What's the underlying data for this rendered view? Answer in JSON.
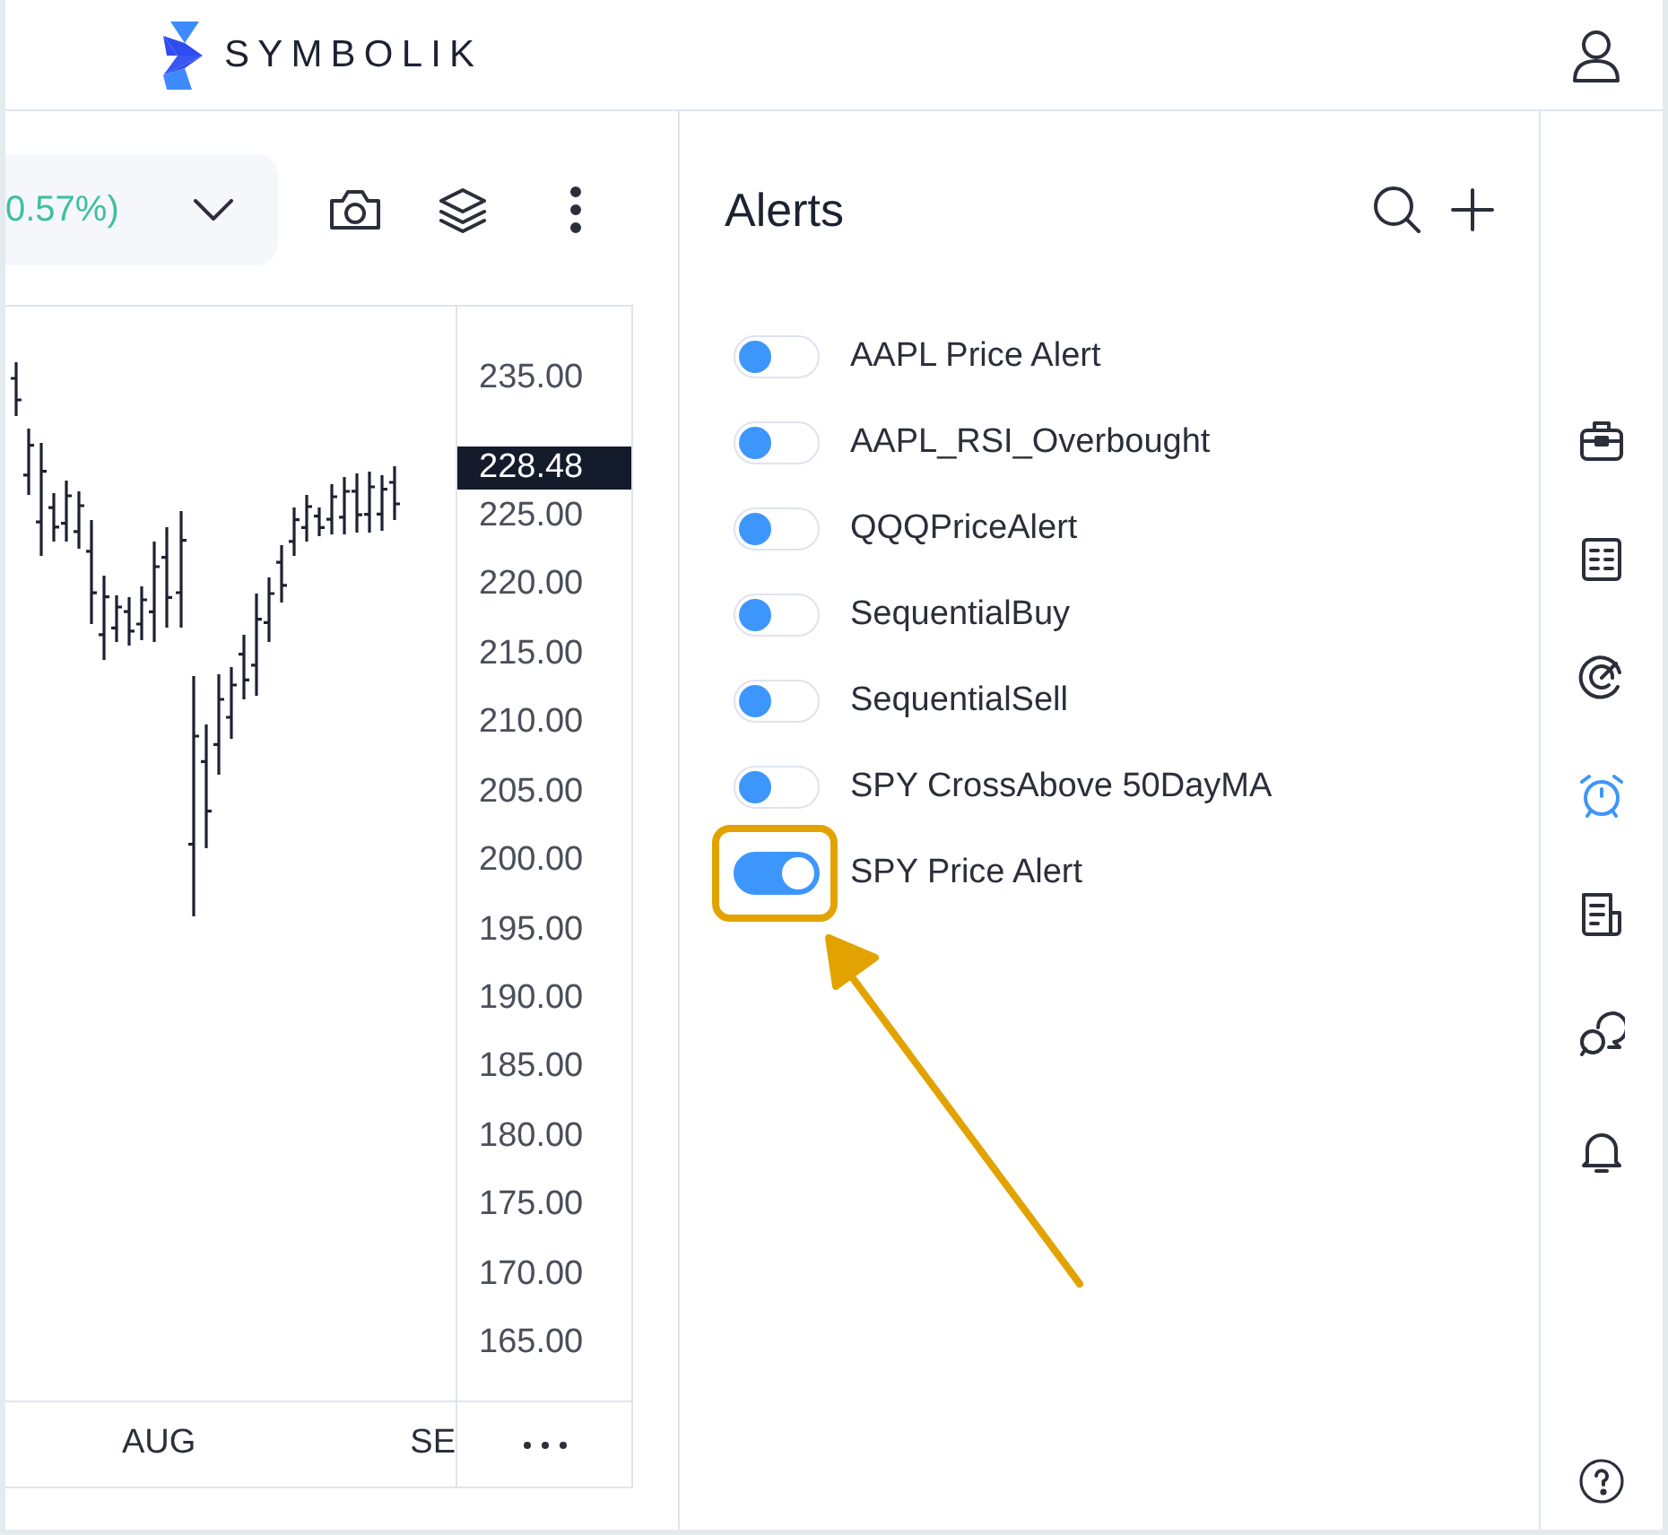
{
  "header": {
    "logo_text": "SYMBOLIK"
  },
  "chart_toolbar": {
    "change": "0.57%)"
  },
  "chart": {
    "price_axis": [
      {
        "kind": "tick",
        "text": "235.00"
      },
      {
        "kind": "current",
        "text": "228.48"
      },
      {
        "kind": "tick",
        "text": "225.00"
      },
      {
        "kind": "tick",
        "text": "220.00"
      },
      {
        "kind": "tick",
        "text": "215.00"
      },
      {
        "kind": "tick",
        "text": "210.00"
      },
      {
        "kind": "tick",
        "text": "205.00"
      },
      {
        "kind": "tick",
        "text": "200.00"
      },
      {
        "kind": "tick",
        "text": "195.00"
      },
      {
        "kind": "tick",
        "text": "190.00"
      },
      {
        "kind": "tick",
        "text": "185.00"
      },
      {
        "kind": "tick",
        "text": "180.00"
      },
      {
        "kind": "tick",
        "text": "175.00"
      },
      {
        "kind": "tick",
        "text": "170.00"
      },
      {
        "kind": "tick",
        "text": "165.00"
      }
    ],
    "time_labels": [
      "AUG",
      "SE"
    ]
  },
  "alerts": {
    "title": "Alerts",
    "items": [
      {
        "name": "AAPL Price Alert",
        "on": false,
        "highlighted": false
      },
      {
        "name": "AAPL_RSI_Overbought",
        "on": false,
        "highlighted": false
      },
      {
        "name": "QQQPriceAlert",
        "on": false,
        "highlighted": false
      },
      {
        "name": "SequentialBuy",
        "on": false,
        "highlighted": false
      },
      {
        "name": "SequentialSell",
        "on": false,
        "highlighted": false
      },
      {
        "name": "SPY CrossAbove 50DayMA",
        "on": false,
        "highlighted": false
      },
      {
        "name": "SPY Price Alert",
        "on": true,
        "highlighted": true
      }
    ]
  },
  "sidebar": {
    "items": [
      {
        "selected": false
      },
      {
        "selected": false
      },
      {
        "selected": false
      },
      {
        "selected": true
      },
      {
        "selected": false
      },
      {
        "selected": false
      },
      {
        "selected": false
      }
    ]
  }
}
